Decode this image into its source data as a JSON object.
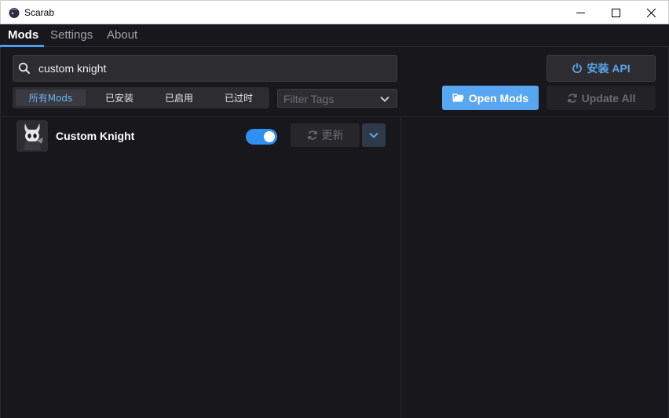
{
  "window": {
    "title": "Scarab"
  },
  "tabs": [
    {
      "label": "Mods",
      "active": true
    },
    {
      "label": "Settings",
      "active": false
    },
    {
      "label": "About",
      "active": false
    }
  ],
  "search": {
    "value": "custom knight",
    "icon": "search-icon"
  },
  "filters": [
    {
      "label": "所有Mods",
      "active": true
    },
    {
      "label": "已安装",
      "active": false
    },
    {
      "label": "已启用",
      "active": false
    },
    {
      "label": "已过时",
      "active": false
    }
  ],
  "tag_filter": {
    "placeholder": "Filter Tags"
  },
  "buttons": {
    "install_api": "安装 API",
    "open_mods": "Open Mods",
    "update_all": "Update All"
  },
  "mods": [
    {
      "name": "Custom Knight",
      "enabled": true,
      "update_label": "更新"
    }
  ],
  "colors": {
    "accent": "#58a6f2",
    "background": "#17171c",
    "toggle_on": "#2f8ff2"
  }
}
